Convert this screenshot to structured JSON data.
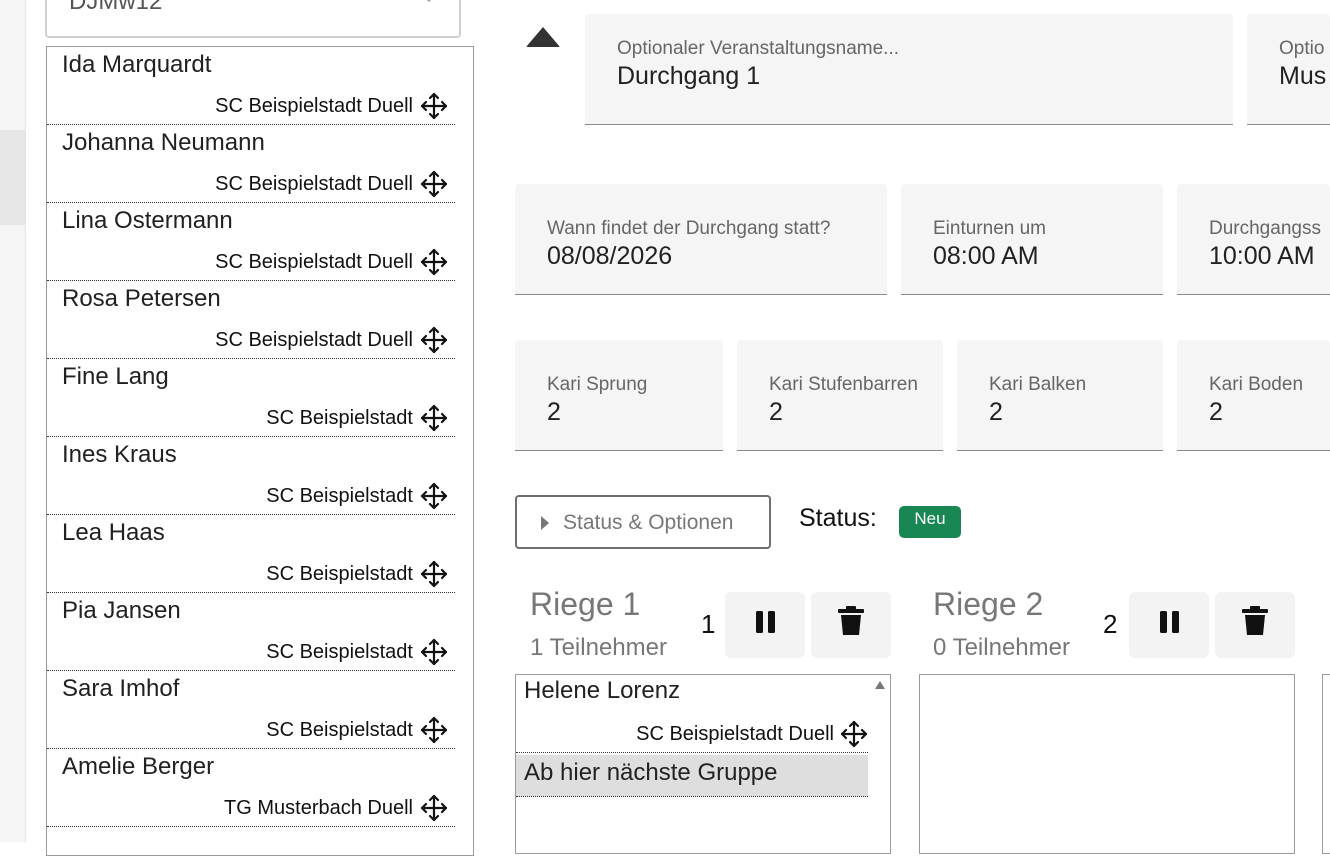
{
  "filter": {
    "selected": "DJMw12"
  },
  "participants": [
    {
      "name": "Ida Marquardt",
      "club": "SC Beispielstadt Duell"
    },
    {
      "name": "Johanna Neumann",
      "club": "SC Beispielstadt Duell"
    },
    {
      "name": "Lina Ostermann",
      "club": "SC Beispielstadt Duell"
    },
    {
      "name": "Rosa Petersen",
      "club": "SC Beispielstadt Duell"
    },
    {
      "name": "Fine Lang",
      "club": "SC Beispielstadt"
    },
    {
      "name": "Ines Kraus",
      "club": "SC Beispielstadt"
    },
    {
      "name": "Lea Haas",
      "club": "SC Beispielstadt"
    },
    {
      "name": "Pia Jansen",
      "club": "SC Beispielstadt"
    },
    {
      "name": "Sara Imhof",
      "club": "SC Beispielstadt"
    },
    {
      "name": "Amelie Berger",
      "club": "TG Musterbach Duell"
    }
  ],
  "form": {
    "event_name": {
      "label": "Optionaler Veranstaltungsname...",
      "value": "Durchgang 1"
    },
    "event_other": {
      "label": "Optio",
      "value": "Mus"
    },
    "date": {
      "label": "Wann findet der Durchgang statt?",
      "value": "08/08/2026"
    },
    "warmup": {
      "label": "Einturnen um",
      "value": "08:00 AM"
    },
    "start": {
      "label": "Durchgangss",
      "value": "10:00 AM"
    },
    "kari_sprung": {
      "label": "Kari Sprung",
      "value": "2"
    },
    "kari_stufenbarren": {
      "label": "Kari Stufenbarren",
      "value": "2"
    },
    "kari_balken": {
      "label": "Kari Balken",
      "value": "2"
    },
    "kari_boden": {
      "label": "Kari Boden",
      "value": "2"
    }
  },
  "status": {
    "toggle_label": "Status & Optionen",
    "label": "Status:",
    "badge": "Neu",
    "badge_color": "#188754"
  },
  "riegen": [
    {
      "title": "Riege 1",
      "count": "1 Teilnehmer",
      "number": "1",
      "members": [
        {
          "name": "Helene Lorenz",
          "club": "SC Beispielstadt Duell"
        }
      ],
      "separator": "Ab hier nächste Gruppe"
    },
    {
      "title": "Riege 2",
      "count": "0 Teilnehmer",
      "number": "2",
      "members": []
    }
  ],
  "icons": {
    "move": "move-arrows-icon",
    "pause": "pause-icon",
    "delete": "trash-icon",
    "collapse": "chevron-up-icon"
  }
}
